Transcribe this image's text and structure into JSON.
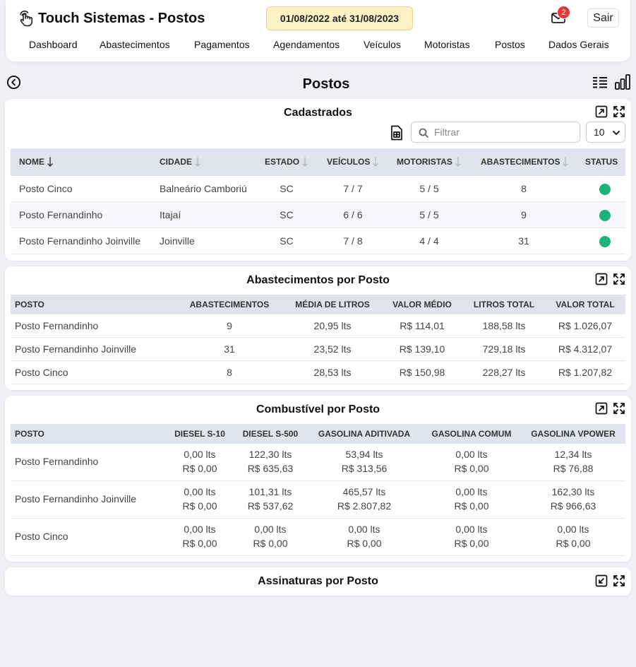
{
  "header": {
    "title": "Touch Sistemas - Postos",
    "date_range": "01/08/2022 até 31/08/2023",
    "mail_count": "2",
    "logout_label": "Sair",
    "nav": [
      "Dashboard",
      "Abastecimentos",
      "Pagamentos",
      "Agendamentos",
      "Veículos",
      "Motoristas",
      "Postos",
      "Dados Gerais"
    ]
  },
  "page": {
    "title": "Postos"
  },
  "cadastrados": {
    "title": "Cadastrados",
    "filter_placeholder": "Filtrar",
    "page_size": "10",
    "columns": [
      "Nome",
      "Cidade",
      "Estado",
      "Veículos",
      "Motoristas",
      "Abastecimentos",
      "Status"
    ],
    "rows": [
      {
        "nome": "Posto Cinco",
        "cidade": "Balneário Camboriú",
        "estado": "SC",
        "veiculos": "7 / 7",
        "motoristas": "5 / 5",
        "abastecimentos": "8",
        "status": "active"
      },
      {
        "nome": "Posto Fernandinho",
        "cidade": "Itajaí",
        "estado": "SC",
        "veiculos": "6 / 6",
        "motoristas": "5 / 5",
        "abastecimentos": "9",
        "status": "active"
      },
      {
        "nome": "Posto Fernandinho Joinville",
        "cidade": "Joinville",
        "estado": "SC",
        "veiculos": "7 / 8",
        "motoristas": "4 / 4",
        "abastecimentos": "31",
        "status": "active"
      }
    ]
  },
  "por_posto": {
    "title": "Abastecimentos por Posto",
    "columns": [
      "Posto",
      "Abastecimentos",
      "Média de Litros",
      "Valor Médio",
      "Litros Total",
      "Valor Total"
    ],
    "rows": [
      {
        "posto": "Posto Fernandinho",
        "abastecimentos": "9",
        "media": "20,95 lts",
        "valor_medio": "R$ 114,01",
        "litros": "188,58 lts",
        "valor_total": "R$ 1.026,07"
      },
      {
        "posto": "Posto Fernandinho Joinville",
        "abastecimentos": "31",
        "media": "23,52 lts",
        "valor_medio": "R$ 139,10",
        "litros": "729,18 lts",
        "valor_total": "R$ 4.312,07"
      },
      {
        "posto": "Posto Cinco",
        "abastecimentos": "8",
        "media": "28,53 lts",
        "valor_medio": "R$ 150,98",
        "litros": "228,27 lts",
        "valor_total": "R$ 1.207,82"
      }
    ]
  },
  "combustivel": {
    "title": "Combustível por Posto",
    "columns": [
      "Posto",
      "Diesel S-10",
      "Diesel S-500",
      "Gasolina Aditivada",
      "Gasolina Comum",
      "Gasolina VPower"
    ],
    "rows": [
      {
        "posto": "Posto Fernandinho",
        "cells": [
          [
            "0,00 lts",
            "R$ 0,00"
          ],
          [
            "122,30 lts",
            "R$ 635,63"
          ],
          [
            "53,94 lts",
            "R$ 313,56"
          ],
          [
            "0,00 lts",
            "R$ 0,00"
          ],
          [
            "12,34 lts",
            "R$ 76,88"
          ]
        ]
      },
      {
        "posto": "Posto Fernandinho Joinville",
        "cells": [
          [
            "0,00 lts",
            "R$ 0,00"
          ],
          [
            "101,31 lts",
            "R$ 537,62"
          ],
          [
            "465,57 lts",
            "R$ 2.807,82"
          ],
          [
            "0,00 lts",
            "R$ 0,00"
          ],
          [
            "162,30 lts",
            "R$ 966,63"
          ]
        ]
      },
      {
        "posto": "Posto Cinco",
        "cells": [
          [
            "0,00 lts",
            "R$ 0,00"
          ],
          [
            "0,00 lts",
            "R$ 0,00"
          ],
          [
            "0,00 lts",
            "R$ 0,00"
          ],
          [
            "0,00 lts",
            "R$ 0,00"
          ],
          [
            "0,00 lts",
            "R$ 0,00"
          ]
        ]
      }
    ]
  },
  "assinaturas": {
    "title": "Assinaturas por Posto"
  }
}
